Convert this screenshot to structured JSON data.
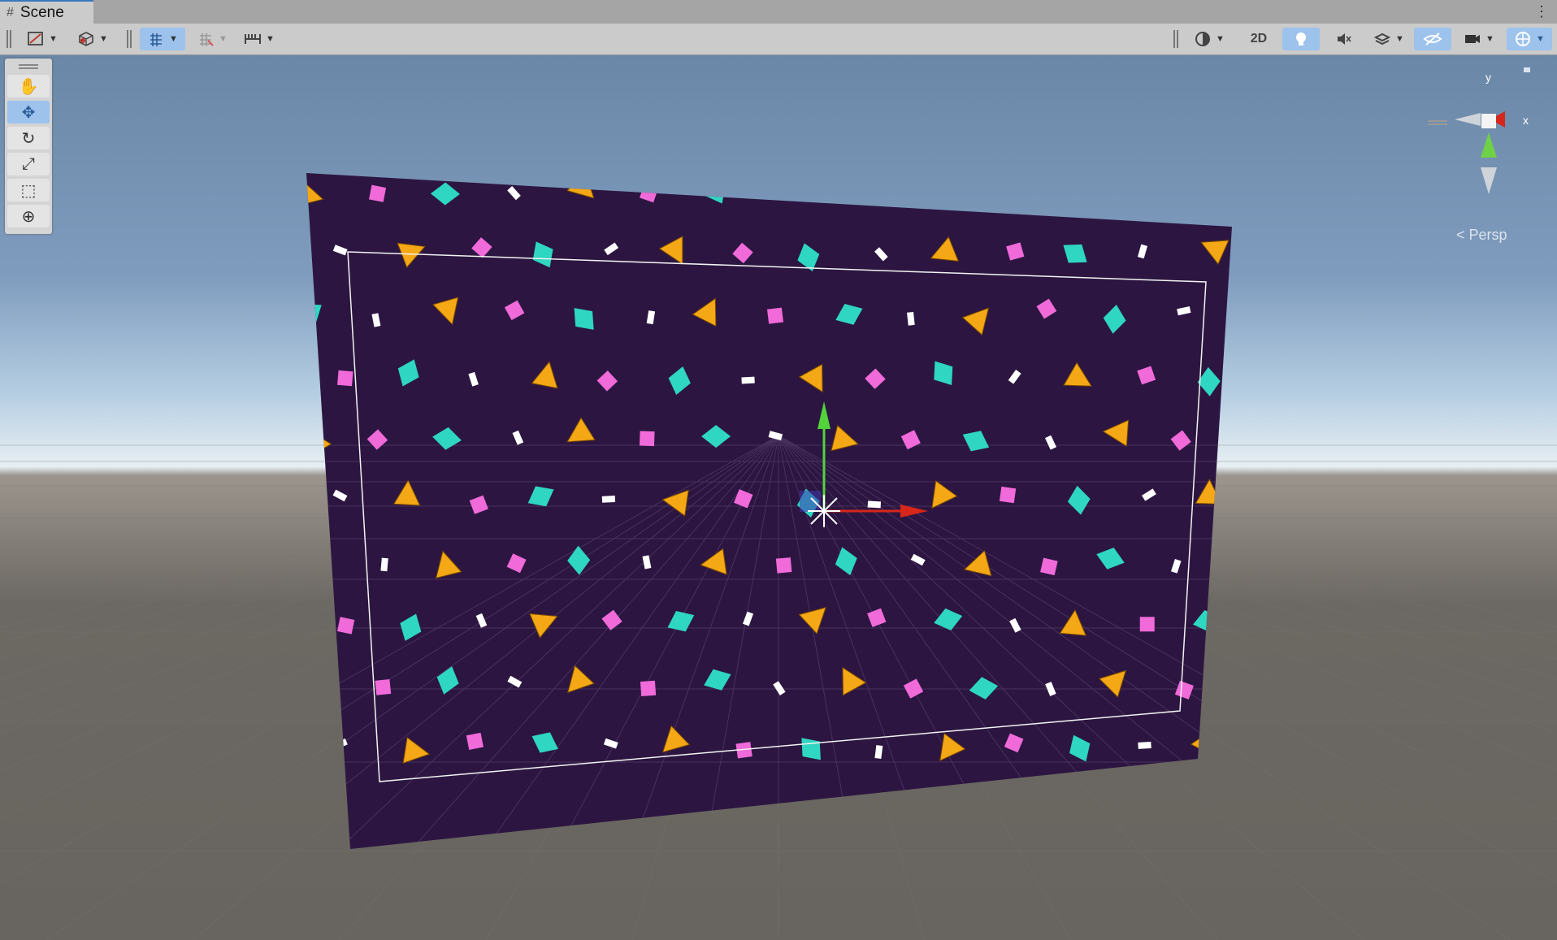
{
  "window": {
    "tab_title": "Scene",
    "tab_icon": "hash-icon",
    "menu_icon": "kebab-icon"
  },
  "toolbar": {
    "left": [
      {
        "name": "draw-mode-button",
        "icon": "shaded-icon",
        "dropdown": true
      },
      {
        "name": "render-mode-button",
        "icon": "cube-icon",
        "dropdown": true
      },
      {
        "name": "grid-snap-button",
        "icon": "grid-snap-icon",
        "dropdown": true,
        "active": true
      },
      {
        "name": "increment-snap-button",
        "icon": "grid-off-icon",
        "dropdown": true
      },
      {
        "name": "ruler-button",
        "icon": "ruler-icon",
        "dropdown": true
      }
    ],
    "right": [
      {
        "name": "render-global-button",
        "icon": "globe-icon",
        "dropdown": true
      },
      {
        "name": "2d-button",
        "label": "2D"
      },
      {
        "name": "lighting-button",
        "icon": "bulb-icon",
        "active": true
      },
      {
        "name": "audio-button",
        "icon": "audio-mute-icon"
      },
      {
        "name": "effects-button",
        "icon": "layers-icon",
        "dropdown": true
      },
      {
        "name": "visibility-button",
        "icon": "eye-off-icon",
        "active": true
      },
      {
        "name": "camera-button",
        "icon": "camera-icon",
        "dropdown": true
      },
      {
        "name": "gizmos-button",
        "icon": "gizmo-icon",
        "dropdown": true,
        "active": true
      }
    ],
    "mode_2d_label": "2D"
  },
  "tools": [
    {
      "name": "hand-tool",
      "icon": "hand-icon",
      "glyph": "✋",
      "active": false
    },
    {
      "name": "move-tool",
      "icon": "move-arrows-icon",
      "glyph": "✥",
      "active": true
    },
    {
      "name": "rotate-tool",
      "icon": "rotate-icon",
      "glyph": "↻",
      "active": false
    },
    {
      "name": "scale-tool",
      "icon": "scale-icon",
      "glyph": "⤢",
      "active": false
    },
    {
      "name": "rect-tool",
      "icon": "rect-icon",
      "glyph": "⬚",
      "active": false
    },
    {
      "name": "transform-tool",
      "icon": "transform-icon",
      "glyph": "⊕",
      "active": false
    }
  ],
  "gizmo": {
    "axis_y": "y",
    "axis_x": "x",
    "projection": "Persp",
    "projection_icon": "chevron-left-icon"
  },
  "colors": {
    "plane": "#2c1641",
    "pink": "#f06ad9",
    "teal": "#2fd6c2",
    "orange": "#f5a815",
    "white": "#ffffff",
    "axis_x": "#d8261a",
    "axis_y": "#52d43a",
    "toolbar_active": "#9dc2ec"
  }
}
